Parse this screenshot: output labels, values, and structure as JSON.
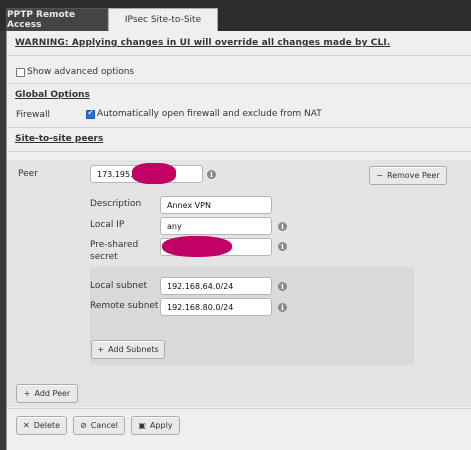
{
  "tabs": [
    {
      "label": "PPTP Remote Access"
    },
    {
      "label": "IPsec Site-to-Site"
    }
  ],
  "warning": "WARNING: Applying changes in UI will override all changes made by CLI.",
  "advanced_options_label": "Show advanced options",
  "global_options": {
    "heading": "Global Options",
    "firewall_label": "Firewall",
    "firewall_option": "Automatically open firewall and exclude from NAT"
  },
  "site_to_site": {
    "heading": "Site-to-site peers",
    "peer_label": "Peer",
    "peer_value": "173.195.",
    "remove_peer": "Remove Peer",
    "description_label": "Description",
    "description_value": "Annex VPN",
    "local_ip_label": "Local IP",
    "local_ip_value": "any",
    "psk_label_1": "Pre-shared",
    "psk_label_2": "secret",
    "local_subnet_label": "Local subnet",
    "local_subnet_value": "192.168.64.0/24",
    "remote_subnet_label": "Remote subnet",
    "remote_subnet_value": "192.168.80.0/24",
    "add_subnets": "Add Subnets",
    "add_peer": "Add Peer"
  },
  "actions": {
    "delete": "Delete",
    "cancel": "Cancel",
    "apply": "Apply"
  },
  "colors": {
    "redaction": "#c10065",
    "checkbox_accent": "#2a6fdb"
  }
}
